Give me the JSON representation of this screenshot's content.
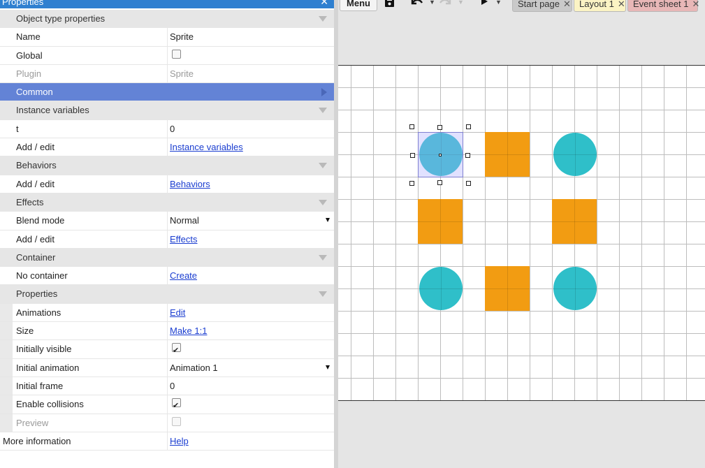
{
  "panel": {
    "title": "Properties",
    "close_icon": "close-icon",
    "rows": [
      {
        "id": "object-type-properties",
        "kind": "cat",
        "label": "Object type properties"
      },
      {
        "id": "name",
        "kind": "text",
        "label": "Name",
        "value": "Sprite"
      },
      {
        "id": "global",
        "kind": "check",
        "label": "Global",
        "checked": false
      },
      {
        "id": "plugin",
        "kind": "text",
        "label": "Plugin",
        "value": "Sprite",
        "dim": true
      },
      {
        "id": "common",
        "kind": "selcat",
        "label": "Common"
      },
      {
        "id": "instance-variables",
        "kind": "cat",
        "label": "Instance variables"
      },
      {
        "id": "t",
        "kind": "text",
        "label": "t",
        "value": "0"
      },
      {
        "id": "instance-variables-edit",
        "kind": "link",
        "label": "Add / edit",
        "value": "Instance variables"
      },
      {
        "id": "behaviors",
        "kind": "cat",
        "label": "Behaviors"
      },
      {
        "id": "behaviors-edit",
        "kind": "link",
        "label": "Add / edit",
        "value": "Behaviors"
      },
      {
        "id": "effects",
        "kind": "cat",
        "label": "Effects"
      },
      {
        "id": "blend-mode",
        "kind": "select",
        "label": "Blend mode",
        "value": "Normal"
      },
      {
        "id": "effects-edit",
        "kind": "link",
        "label": "Add / edit",
        "value": "Effects"
      },
      {
        "id": "container",
        "kind": "cat",
        "label": "Container"
      },
      {
        "id": "container-create",
        "kind": "link",
        "label": "No container",
        "value": "Create"
      },
      {
        "id": "properties",
        "kind": "cat",
        "label": "Properties"
      },
      {
        "id": "animations",
        "kind": "link",
        "label": "Animations",
        "value": "Edit",
        "nest": true
      },
      {
        "id": "size",
        "kind": "link",
        "label": "Size",
        "value": "Make 1:1",
        "nest": true
      },
      {
        "id": "initially-visible",
        "kind": "check",
        "label": "Initially visible",
        "checked": true,
        "nest": true
      },
      {
        "id": "initial-animation",
        "kind": "select",
        "label": "Initial animation",
        "value": "Animation 1",
        "nest": true
      },
      {
        "id": "initial-frame",
        "kind": "text",
        "label": "Initial frame",
        "value": "0",
        "nest": true
      },
      {
        "id": "enable-collisions",
        "kind": "check",
        "label": "Enable collisions",
        "checked": true,
        "nest": true
      },
      {
        "id": "preview",
        "kind": "check",
        "label": "Preview",
        "checked": false,
        "dim": true,
        "nest": true
      },
      {
        "id": "more-information",
        "kind": "link",
        "label": "More information",
        "value": "Help",
        "full": true
      }
    ]
  },
  "toolbar": {
    "menu_label": "Menu",
    "save_icon": "save-icon",
    "undo_icon": "undo-icon",
    "redo_icon": "redo-icon",
    "run_icon": "play-icon"
  },
  "tabs": [
    {
      "id": "start-page",
      "label": "Start page"
    },
    {
      "id": "layout-1",
      "label": "Layout 1"
    },
    {
      "id": "event-sheet-1",
      "label": "Event sheet 1"
    }
  ],
  "colors": {
    "title_bar": "#2f80d0",
    "selected_category": "#6383d6",
    "circle_sprite": "#2fbfc9",
    "square_sprite": "#f29c12",
    "tab_layout": "#fbf3c4",
    "tab_event_sheet": "#e8b7b7"
  }
}
